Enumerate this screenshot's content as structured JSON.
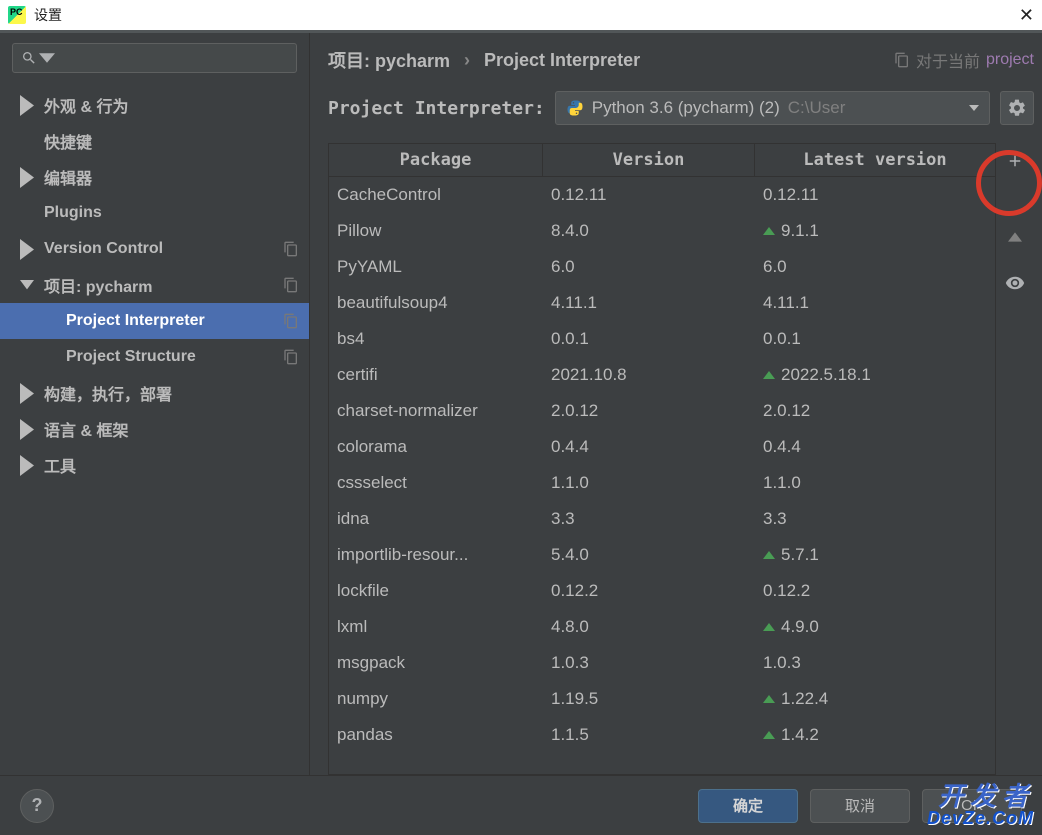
{
  "window": {
    "title": "设置"
  },
  "sidebar": {
    "items": [
      {
        "label": "外观 & 行为",
        "arrow": "right",
        "copy": false
      },
      {
        "label": "快捷键",
        "arrow": "none",
        "copy": false
      },
      {
        "label": "编辑器",
        "arrow": "right",
        "copy": false
      },
      {
        "label": "Plugins",
        "arrow": "none",
        "copy": false
      },
      {
        "label": "Version Control",
        "arrow": "right",
        "copy": true
      },
      {
        "label": "项目: pycharm",
        "arrow": "down",
        "copy": true
      },
      {
        "label": "Project Interpreter",
        "arrow": "child",
        "copy": true,
        "selected": true
      },
      {
        "label": "Project Structure",
        "arrow": "child",
        "copy": true
      },
      {
        "label": "构建，执行，部署",
        "arrow": "right",
        "copy": false
      },
      {
        "label": "语言 & 框架",
        "arrow": "right",
        "copy": false
      },
      {
        "label": "工具",
        "arrow": "right",
        "copy": false
      }
    ]
  },
  "breadcrumb": {
    "l1": "项目: pycharm",
    "l2": "Project Interpreter",
    "aux_label": "对于当前",
    "aux_scope": "project"
  },
  "interpreter": {
    "label": "Project Interpreter:",
    "name": "Python 3.6 (pycharm) (2)",
    "path": "C:\\User"
  },
  "table": {
    "headers": {
      "package": "Package",
      "version": "Version",
      "latest": "Latest version"
    },
    "rows": [
      {
        "pkg": "CacheControl",
        "ver": "0.12.11",
        "lat": "0.12.11",
        "update": false
      },
      {
        "pkg": "Pillow",
        "ver": "8.4.0",
        "lat": "9.1.1",
        "update": true
      },
      {
        "pkg": "PyYAML",
        "ver": "6.0",
        "lat": "6.0",
        "update": false
      },
      {
        "pkg": "beautifulsoup4",
        "ver": "4.11.1",
        "lat": "4.11.1",
        "update": false
      },
      {
        "pkg": "bs4",
        "ver": "0.0.1",
        "lat": "0.0.1",
        "update": false
      },
      {
        "pkg": "certifi",
        "ver": "2021.10.8",
        "lat": "2022.5.18.1",
        "update": true
      },
      {
        "pkg": "charset-normalizer",
        "ver": "2.0.12",
        "lat": "2.0.12",
        "update": false
      },
      {
        "pkg": "colorama",
        "ver": "0.4.4",
        "lat": "0.4.4",
        "update": false
      },
      {
        "pkg": "cssselect",
        "ver": "1.1.0",
        "lat": "1.1.0",
        "update": false
      },
      {
        "pkg": "idna",
        "ver": "3.3",
        "lat": "3.3",
        "update": false
      },
      {
        "pkg": "importlib-resour...",
        "ver": "5.4.0",
        "lat": "5.7.1",
        "update": true
      },
      {
        "pkg": "lockfile",
        "ver": "0.12.2",
        "lat": "0.12.2",
        "update": false
      },
      {
        "pkg": "lxml",
        "ver": "4.8.0",
        "lat": "4.9.0",
        "update": true
      },
      {
        "pkg": "msgpack",
        "ver": "1.0.3",
        "lat": "1.0.3",
        "update": false
      },
      {
        "pkg": "numpy",
        "ver": "1.19.5",
        "lat": "1.22.4",
        "update": true
      },
      {
        "pkg": "pandas",
        "ver": "1.1.5",
        "lat": "1.4.2",
        "update": true
      }
    ]
  },
  "footer": {
    "ok": "确定",
    "cancel": "取消",
    "apply": "OK"
  },
  "watermark": {
    "l1": "开发者",
    "l2": "DevZe.CoM"
  }
}
